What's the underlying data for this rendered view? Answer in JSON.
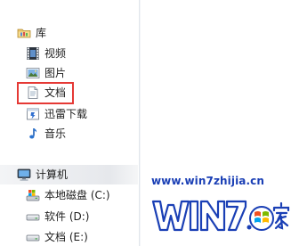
{
  "nav": {
    "libraries": {
      "label": "库",
      "icon": "library-folder-icon",
      "items": [
        {
          "label": "视频",
          "icon": "video-library-icon"
        },
        {
          "label": "图片",
          "icon": "picture-library-icon"
        },
        {
          "label": "文档",
          "icon": "document-library-icon",
          "highlighted": true
        },
        {
          "label": "迅雷下载",
          "icon": "thunder-download-icon"
        },
        {
          "label": "音乐",
          "icon": "music-library-icon"
        }
      ]
    },
    "computer": {
      "label": "计算机",
      "icon": "computer-icon",
      "drives": [
        {
          "label": "本地磁盘 (C:)",
          "icon": "system-drive-icon"
        },
        {
          "label": "软件 (D:)",
          "icon": "drive-icon"
        },
        {
          "label": "文档 (E:)",
          "icon": "drive-icon"
        }
      ]
    }
  },
  "highlight": {
    "color": "#e53935",
    "target": "文档"
  },
  "watermark": {
    "url": "www.win7zhijia.cn",
    "url_color": "#1a3fb5",
    "logo": "win7-zhijia-logo"
  }
}
